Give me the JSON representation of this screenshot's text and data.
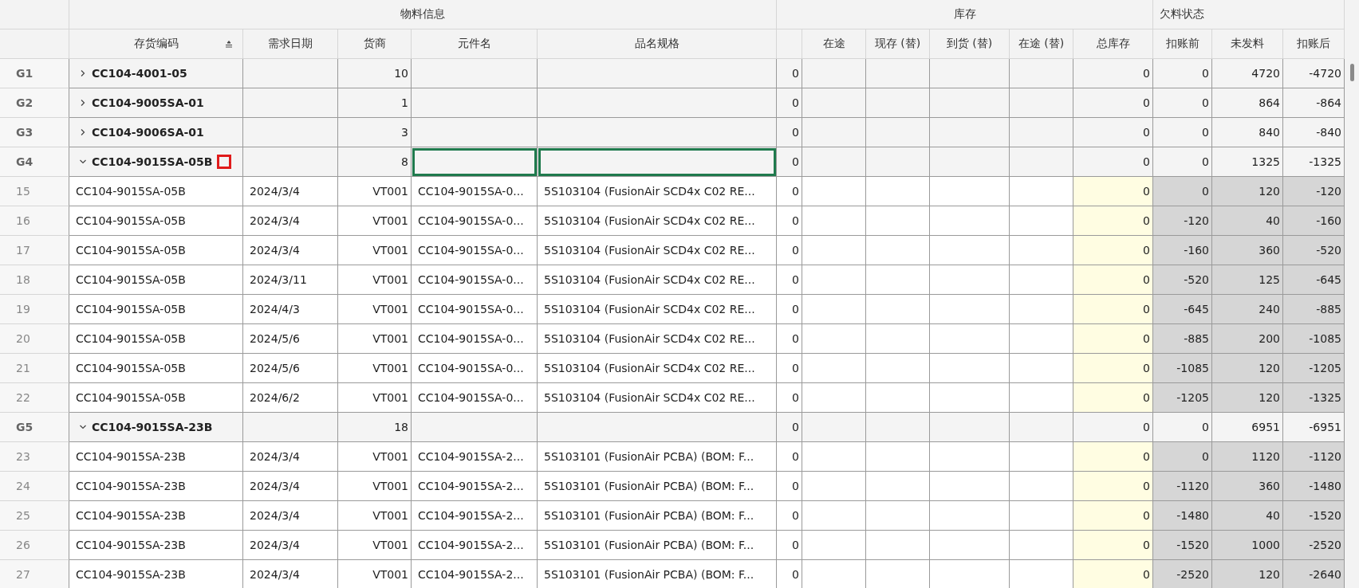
{
  "column_groups": [
    {
      "label": "物料信息",
      "columns": [
        {
          "label": "存货编码",
          "kind": "text",
          "sorted": true
        },
        {
          "label": "需求日期",
          "kind": "text",
          "sorted": false
        },
        {
          "label": "货商",
          "kind": "number",
          "sorted": false
        },
        {
          "label": "元件名",
          "kind": "text",
          "sorted": false
        },
        {
          "label": "品名规格",
          "kind": "text",
          "sorted": false
        }
      ]
    },
    {
      "label": "库存",
      "columns": [
        {
          "kind": "number",
          "sorted": false
        },
        {
          "label": "在途",
          "kind": "number",
          "sorted": false
        },
        {
          "label": "现存 (替)",
          "kind": "number",
          "sorted": false
        },
        {
          "label": "到货 (替)",
          "kind": "number",
          "sorted": false
        },
        {
          "label": "在途 (替)",
          "kind": "number",
          "sorted": false
        },
        {
          "label": "总库存",
          "kind": "total",
          "sorted": false
        }
      ]
    },
    {
      "label": "欠料状态",
      "columns": [
        {
          "label": "扣账前",
          "kind": "shortage",
          "sorted": false
        },
        {
          "label": "未发料",
          "kind": "shortage",
          "sorted": false
        },
        {
          "label": "扣账后",
          "kind": "shortage",
          "sorted": false
        }
      ]
    }
  ],
  "rows": [
    {
      "kind": "group",
      "label": "G1",
      "expanded": false,
      "selected": false,
      "flagged": false,
      "cells": [
        "CC104-4001-05",
        null,
        "10",
        null,
        null,
        "0",
        null,
        null,
        null,
        null,
        "0",
        "0",
        "4720",
        "-4720"
      ]
    },
    {
      "kind": "group",
      "label": "G2",
      "expanded": false,
      "selected": false,
      "flagged": false,
      "cells": [
        "CC104-9005SA-01",
        null,
        "1",
        null,
        null,
        "0",
        null,
        null,
        null,
        null,
        "0",
        "0",
        "864",
        "-864"
      ]
    },
    {
      "kind": "group",
      "label": "G3",
      "expanded": false,
      "selected": false,
      "flagged": false,
      "cells": [
        "CC104-9006SA-01",
        null,
        "3",
        null,
        null,
        "0",
        null,
        null,
        null,
        null,
        "0",
        "0",
        "840",
        "-840"
      ]
    },
    {
      "kind": "group",
      "label": "G4",
      "expanded": true,
      "selected": true,
      "flagged": true,
      "cells": [
        "CC104-9015SA-05B",
        null,
        "8",
        null,
        null,
        "0",
        null,
        null,
        null,
        null,
        "0",
        "0",
        "1325",
        "-1325"
      ]
    },
    {
      "kind": "item",
      "label": "15",
      "selected": false,
      "flagged": false,
      "cells": [
        "CC104-9015SA-05B",
        "2024/3/4",
        "VT001",
        "CC104-9015SA-0...",
        "5S103104 (FusionAir SCD4x C02 RE...",
        "0",
        null,
        null,
        null,
        null,
        "0",
        "0",
        "120",
        "-120"
      ]
    },
    {
      "kind": "item",
      "label": "16",
      "selected": false,
      "flagged": false,
      "cells": [
        "CC104-9015SA-05B",
        "2024/3/4",
        "VT001",
        "CC104-9015SA-0...",
        "5S103104 (FusionAir SCD4x C02 RE...",
        "0",
        null,
        null,
        null,
        null,
        "0",
        "-120",
        "40",
        "-160"
      ]
    },
    {
      "kind": "item",
      "label": "17",
      "selected": false,
      "flagged": false,
      "cells": [
        "CC104-9015SA-05B",
        "2024/3/4",
        "VT001",
        "CC104-9015SA-0...",
        "5S103104 (FusionAir SCD4x C02 RE...",
        "0",
        null,
        null,
        null,
        null,
        "0",
        "-160",
        "360",
        "-520"
      ]
    },
    {
      "kind": "item",
      "label": "18",
      "selected": false,
      "flagged": false,
      "cells": [
        "CC104-9015SA-05B",
        "2024/3/11",
        "VT001",
        "CC104-9015SA-0...",
        "5S103104 (FusionAir SCD4x C02 RE...",
        "0",
        null,
        null,
        null,
        null,
        "0",
        "-520",
        "125",
        "-645"
      ]
    },
    {
      "kind": "item",
      "label": "19",
      "selected": false,
      "flagged": false,
      "cells": [
        "CC104-9015SA-05B",
        "2024/4/3",
        "VT001",
        "CC104-9015SA-0...",
        "5S103104 (FusionAir SCD4x C02 RE...",
        "0",
        null,
        null,
        null,
        null,
        "0",
        "-645",
        "240",
        "-885"
      ]
    },
    {
      "kind": "item",
      "label": "20",
      "selected": false,
      "flagged": false,
      "cells": [
        "CC104-9015SA-05B",
        "2024/5/6",
        "VT001",
        "CC104-9015SA-0...",
        "5S103104 (FusionAir SCD4x C02 RE...",
        "0",
        null,
        null,
        null,
        null,
        "0",
        "-885",
        "200",
        "-1085"
      ]
    },
    {
      "kind": "item",
      "label": "21",
      "selected": false,
      "flagged": false,
      "cells": [
        "CC104-9015SA-05B",
        "2024/5/6",
        "VT001",
        "CC104-9015SA-0...",
        "5S103104 (FusionAir SCD4x C02 RE...",
        "0",
        null,
        null,
        null,
        null,
        "0",
        "-1085",
        "120",
        "-1205"
      ]
    },
    {
      "kind": "item",
      "label": "22",
      "selected": false,
      "flagged": false,
      "cells": [
        "CC104-9015SA-05B",
        "2024/6/2",
        "VT001",
        "CC104-9015SA-0...",
        "5S103104 (FusionAir SCD4x C02 RE...",
        "0",
        null,
        null,
        null,
        null,
        "0",
        "-1205",
        "120",
        "-1325"
      ]
    },
    {
      "kind": "group",
      "label": "G5",
      "expanded": true,
      "selected": false,
      "flagged": false,
      "cells": [
        "CC104-9015SA-23B",
        null,
        "18",
        null,
        null,
        "0",
        null,
        null,
        null,
        null,
        "0",
        "0",
        "6951",
        "-6951"
      ]
    },
    {
      "kind": "item",
      "label": "23",
      "selected": false,
      "flagged": false,
      "cells": [
        "CC104-9015SA-23B",
        "2024/3/4",
        "VT001",
        "CC104-9015SA-2...",
        "5S103101 (FusionAir PCBA) (BOM: F...",
        "0",
        null,
        null,
        null,
        null,
        "0",
        "0",
        "1120",
        "-1120"
      ]
    },
    {
      "kind": "item",
      "label": "24",
      "selected": false,
      "flagged": false,
      "cells": [
        "CC104-9015SA-23B",
        "2024/3/4",
        "VT001",
        "CC104-9015SA-2...",
        "5S103101 (FusionAir PCBA) (BOM: F...",
        "0",
        null,
        null,
        null,
        null,
        "0",
        "-1120",
        "360",
        "-1480"
      ]
    },
    {
      "kind": "item",
      "label": "25",
      "selected": false,
      "flagged": false,
      "cells": [
        "CC104-9015SA-23B",
        "2024/3/4",
        "VT001",
        "CC104-9015SA-2...",
        "5S103101 (FusionAir PCBA) (BOM: F...",
        "0",
        null,
        null,
        null,
        null,
        "0",
        "-1480",
        "40",
        "-1520"
      ]
    },
    {
      "kind": "item",
      "label": "26",
      "selected": false,
      "flagged": false,
      "cells": [
        "CC104-9015SA-23B",
        "2024/3/4",
        "VT001",
        "CC104-9015SA-2...",
        "5S103101 (FusionAir PCBA) (BOM: F...",
        "0",
        null,
        null,
        null,
        null,
        "0",
        "-1520",
        "1000",
        "-2520"
      ]
    },
    {
      "kind": "item",
      "label": "27",
      "selected": false,
      "flagged": false,
      "cells": [
        "CC104-9015SA-23B",
        "2024/3/4",
        "VT001",
        "CC104-9015SA-2...",
        "5S103101 (FusionAir PCBA) (BOM: F...",
        "0",
        null,
        null,
        null,
        null,
        "0",
        "-2520",
        "120",
        "-2640"
      ]
    }
  ]
}
